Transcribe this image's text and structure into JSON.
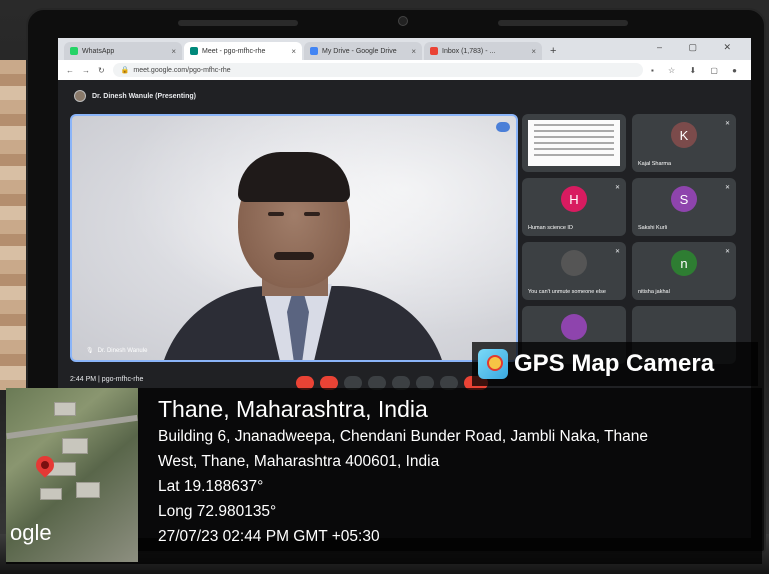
{
  "browser": {
    "tabs": [
      {
        "title": "WhatsApp",
        "color": "#25d366",
        "active": false
      },
      {
        "title": "Meet - pgo-mfhc-rhe",
        "color": "#00897b",
        "active": true
      },
      {
        "title": "My Drive - Google Drive",
        "color": "#4285f4",
        "active": false
      },
      {
        "title": "Inbox (1,783) - ...",
        "color": "#ea4335",
        "active": false
      }
    ],
    "new_tab": "+",
    "url": "meet.google.com/pgo-mfhc-rhe"
  },
  "meet": {
    "presenter": "Dr. Dinesh Wanule (Presenting)",
    "main_video_name": "Dr. Dinesh Wanule",
    "time": "2:44 PM",
    "meeting_code": "pgo-mfhc-rhe",
    "participants": [
      {
        "name": "",
        "initial": "",
        "color": "",
        "type": "doc"
      },
      {
        "name": "Kajal Sharma",
        "initial": "K",
        "color": "#7b4b4b"
      },
      {
        "name": "Human science ID",
        "initial": "H",
        "color": "#d81b60"
      },
      {
        "name": "Sakshi Kurli",
        "initial": "S",
        "color": "#8e44ad"
      },
      {
        "name": "You can't unmute someone else",
        "initial": "",
        "color": "#555"
      },
      {
        "name": "nitisha jakhal",
        "initial": "n",
        "color": "#2e7d32"
      }
    ]
  },
  "gps": {
    "app_name": "GPS Map Camera",
    "city": "Thane, Maharashtra, India",
    "address_line1": "Building 6, Jnanadweepa, Chendani Bunder Road, Jambli Naka, Thane",
    "address_line2": "West, Thane, Maharashtra 400601, India",
    "lat": "Lat 19.188637°",
    "long": "Long 72.980135°",
    "datetime": "27/07/23 02:44 PM GMT +05:30",
    "map_brand": "ogle"
  }
}
